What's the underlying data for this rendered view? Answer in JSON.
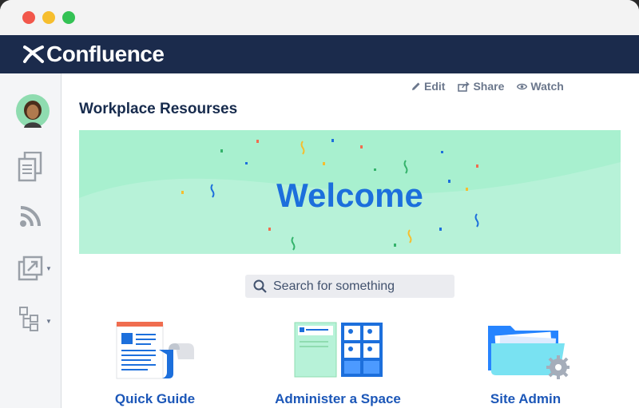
{
  "window": {
    "controls": [
      "close",
      "minimize",
      "maximize"
    ]
  },
  "app": {
    "name": "Confluence"
  },
  "sidebar": {
    "items": [
      {
        "icon": "avatar"
      },
      {
        "icon": "pages-icon"
      },
      {
        "icon": "feed-icon"
      },
      {
        "icon": "export-icon",
        "dropdown": true
      },
      {
        "icon": "tree-icon",
        "dropdown": true
      }
    ]
  },
  "page_actions": {
    "edit": "Edit",
    "share": "Share",
    "watch": "Watch"
  },
  "page": {
    "title": "Workplace Resourses"
  },
  "banner": {
    "text": "Welcome"
  },
  "search": {
    "placeholder": "Search for something"
  },
  "tiles": [
    {
      "label": "Quick Guide",
      "icon": "document-icon"
    },
    {
      "label": "Administer a Space",
      "icon": "space-board-icon"
    },
    {
      "label": "Site Admin",
      "icon": "folder-gear-icon"
    }
  ],
  "colors": {
    "appbar": "#1b2b4c",
    "banner": "#a8f0cf",
    "accent": "#1c6fdc",
    "link": "#1c57b8"
  }
}
